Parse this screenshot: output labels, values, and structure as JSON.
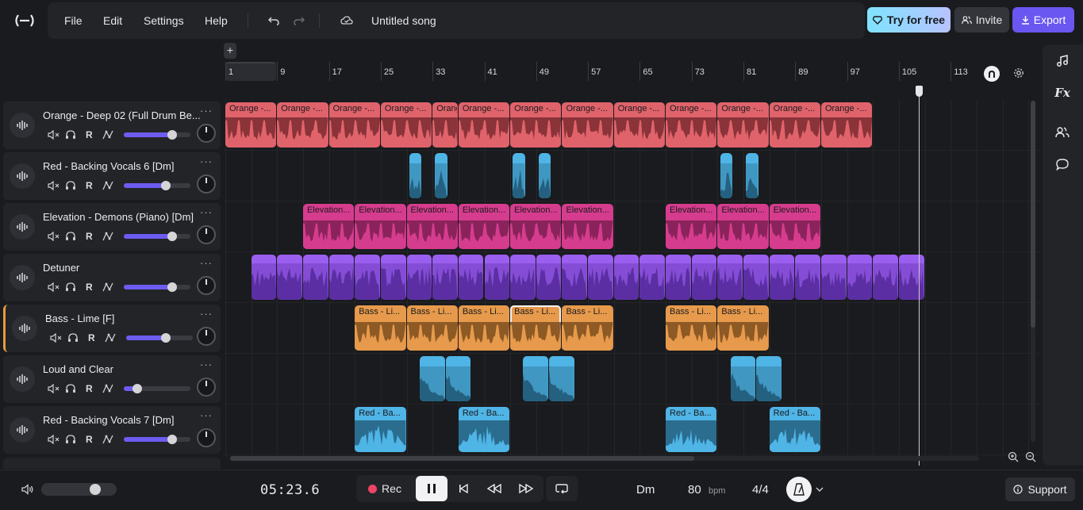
{
  "menu": {
    "file": "File",
    "edit": "Edit",
    "settings": "Settings",
    "help": "Help"
  },
  "song_title": "Untitled song",
  "buttons": {
    "try": "Try for free",
    "invite": "Invite",
    "export": "Export",
    "support": "Support",
    "add_track_top": "+"
  },
  "ruler": [
    "1",
    "9",
    "17",
    "25",
    "33",
    "41",
    "49",
    "57",
    "65",
    "73",
    "81",
    "89",
    "97",
    "105",
    "113"
  ],
  "tracks": [
    {
      "name": "Orange - Deep 02 (Full Drum Be...",
      "volume": 0.73
    },
    {
      "name": "Red - Backing Vocals 6 [Dm]",
      "volume": 0.63
    },
    {
      "name": "Elevation - Demons (Piano) [Dm]",
      "volume": 0.73
    },
    {
      "name": "Detuner",
      "volume": 0.73
    },
    {
      "name": "Bass - Lime [F]",
      "volume": 0.6
    },
    {
      "name": "Loud and Clear",
      "volume": 0.2
    },
    {
      "name": "Red - Backing Vocals 7 [Dm]",
      "volume": 0.73
    }
  ],
  "track_controls": {
    "record": "R"
  },
  "clip_labels": {
    "orange": "Orange -...",
    "elevation": "Elevation...",
    "bass": "Bass - Li...",
    "red": "Red - Ba..."
  },
  "transport": {
    "time": "05:23.6",
    "rec": "Rec",
    "key": "Dm",
    "bpm": "80",
    "bpm_unit": "bpm",
    "signature": "4/4"
  },
  "master_volume": 0.72,
  "colors": {
    "orange": "#e0636b",
    "blue": "#4fb4e6",
    "pink": "#d63c8e",
    "purple": "#9b5ff0",
    "bass": "#e79a4c",
    "accent": "#6a56f0"
  }
}
